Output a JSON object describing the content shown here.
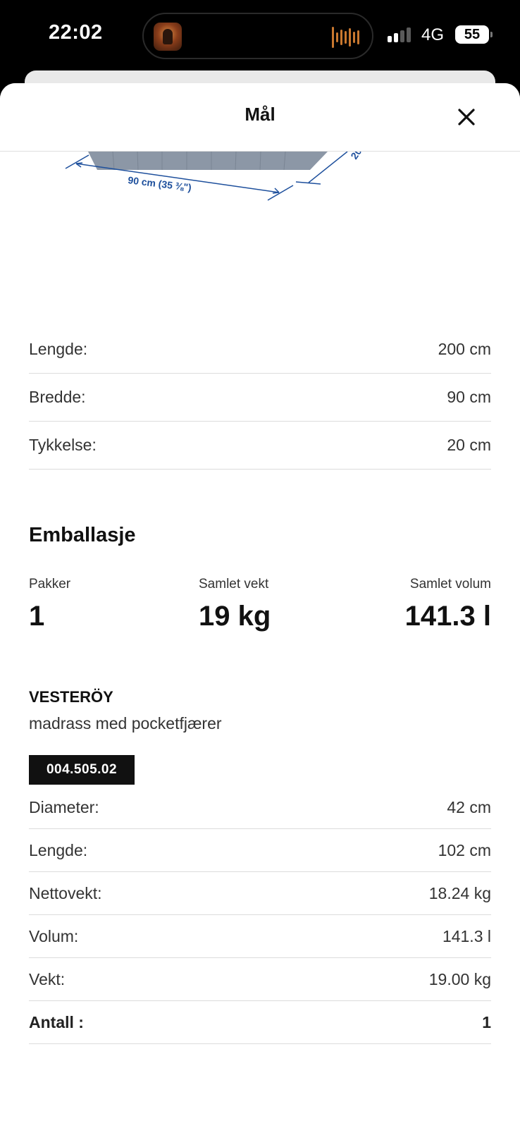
{
  "status_bar": {
    "time": "22:02",
    "network": "4G",
    "battery": "55",
    "signal_bars_active": 2,
    "signal_bars_total": 4
  },
  "sheet": {
    "title": "Mål",
    "close_icon": "close-icon"
  },
  "illustration": {
    "width_label": "90 cm (35 ⅜\")",
    "depth_label_fragment": "20"
  },
  "dimensions": [
    {
      "label": "Lengde:",
      "value": "200 cm"
    },
    {
      "label": "Bredde:",
      "value": "90 cm"
    },
    {
      "label": "Tykkelse:",
      "value": "20 cm"
    }
  ],
  "packaging": {
    "title": "Emballasje",
    "packages_label": "Pakker",
    "packages_value": "1",
    "weight_label": "Samlet vekt",
    "weight_value": "19 kg",
    "volume_label": "Samlet volum",
    "volume_value": "141.3 l"
  },
  "product": {
    "name": "VESTERÖY",
    "description": "madrass med pocketfjærer",
    "article_number": "004.505.02",
    "details": [
      {
        "label": "Diameter:",
        "value": "42 cm"
      },
      {
        "label": "Lengde:",
        "value": "102 cm"
      },
      {
        "label": "Nettovekt:",
        "value": "18.24 kg"
      },
      {
        "label": "Volum:",
        "value": "141.3 l"
      },
      {
        "label": "Vekt:",
        "value": "19.00 kg"
      },
      {
        "label": "Antall :",
        "value": "1"
      }
    ]
  },
  "colors": {
    "dimension_line": "#1d4f9c",
    "mattress": "#8c97a6"
  }
}
